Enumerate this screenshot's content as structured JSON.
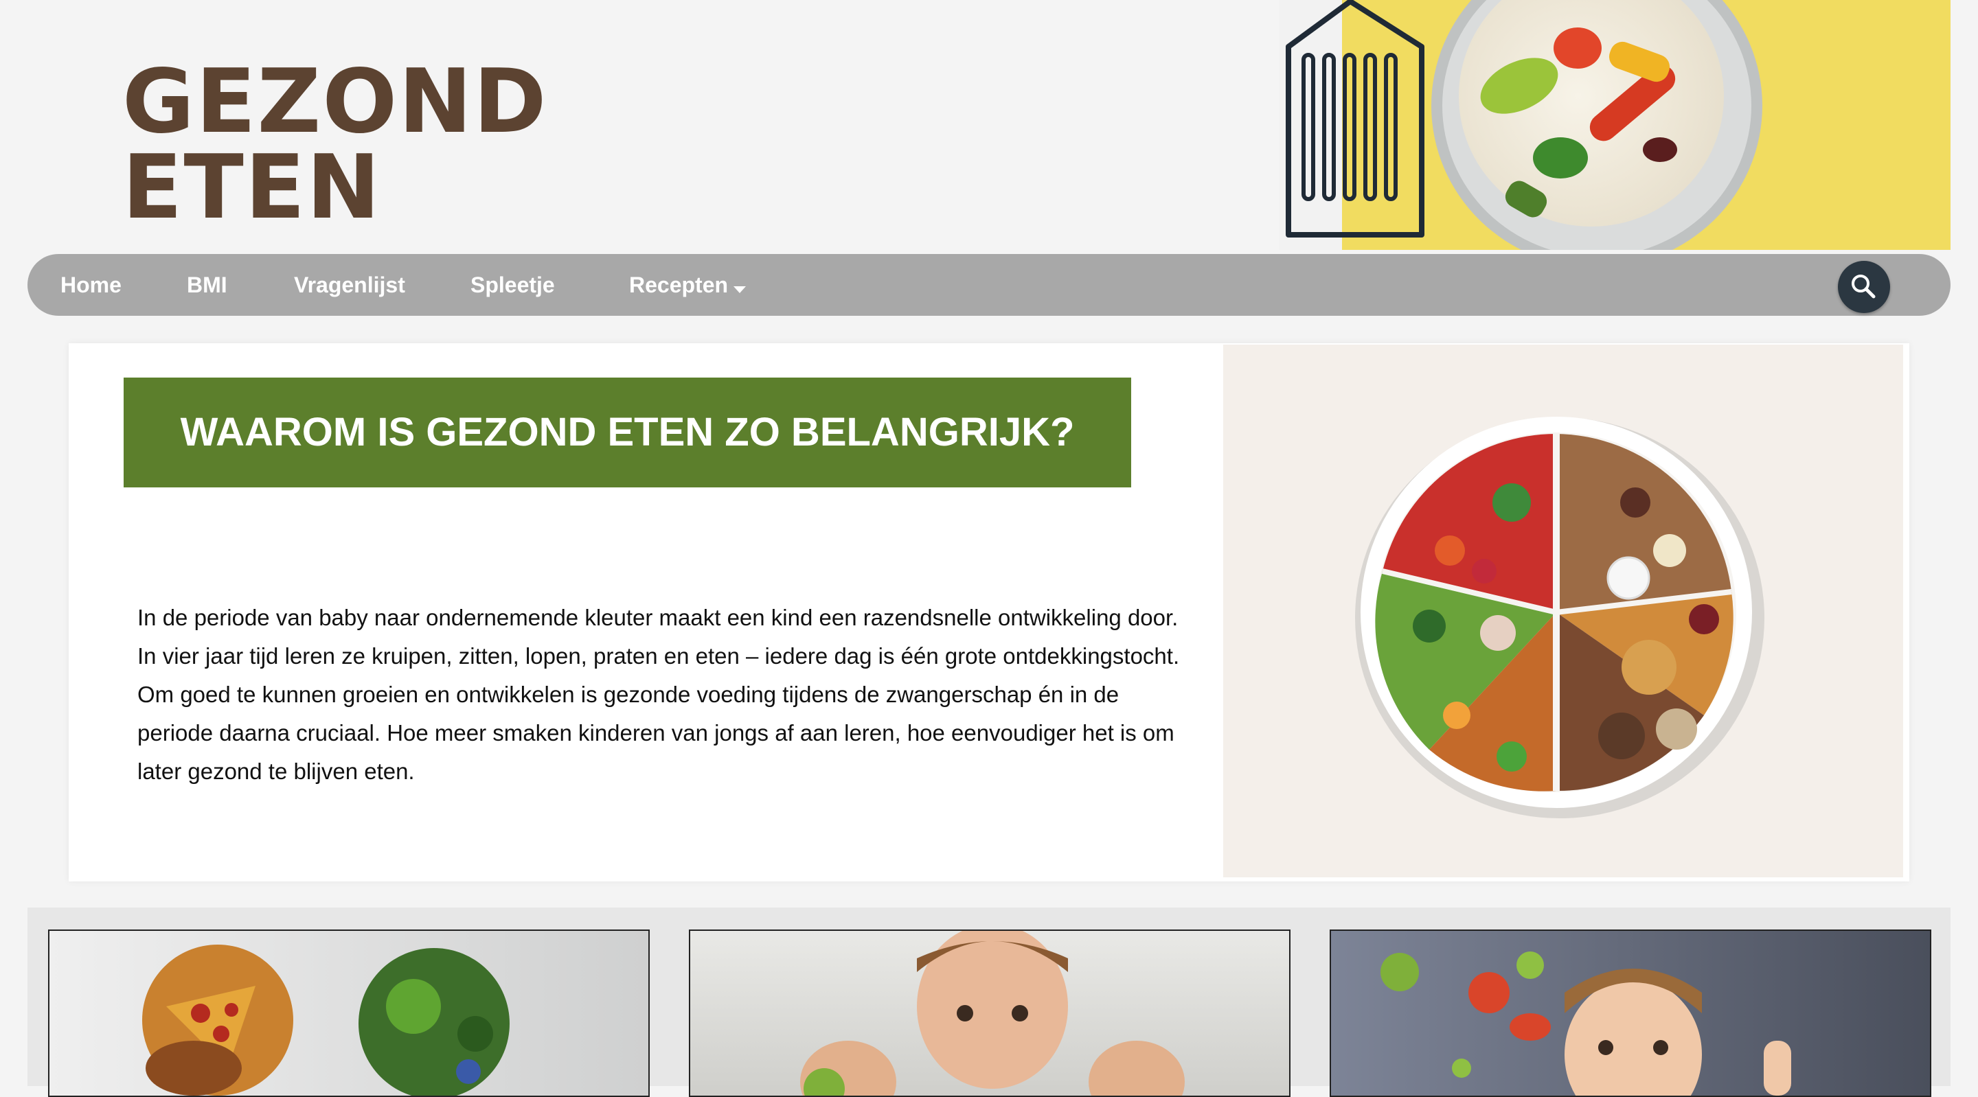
{
  "site": {
    "logo_line1": "GEZOND",
    "logo_line2": "ETEN"
  },
  "nav": {
    "items": [
      {
        "label": "Home"
      },
      {
        "label": "BMI"
      },
      {
        "label": "Vragenlijst"
      },
      {
        "label": "Spleetje"
      },
      {
        "label": "Recepten"
      }
    ],
    "search_icon": "search-icon"
  },
  "intro": {
    "heading": "WAAROM IS GEZOND ETEN ZO BELANGRIJK?",
    "paragraph": "In de periode van baby naar ondernemende kleuter maakt een kind een razendsnelle ontwikkeling door. In vier jaar tijd leren ze kruipen, zitten, lopen, praten en eten – iedere dag is één grote ontdekkingstocht. Om goed te kunnen groeien en ontwikkelen is gezonde voeding tijdens de zwangerschap én in de periode daarna cruciaal. Hoe meer smaken kinderen van jongs af aan leren, hoe eenvoudiger het is om later gezond te blijven eten."
  },
  "colors": {
    "logo": "#5c4331",
    "nav_bg": "#a8a8a8",
    "banner_green": "#5c7f2c",
    "hero_yellow": "#f1dc60",
    "search_btn": "#2b3741"
  }
}
